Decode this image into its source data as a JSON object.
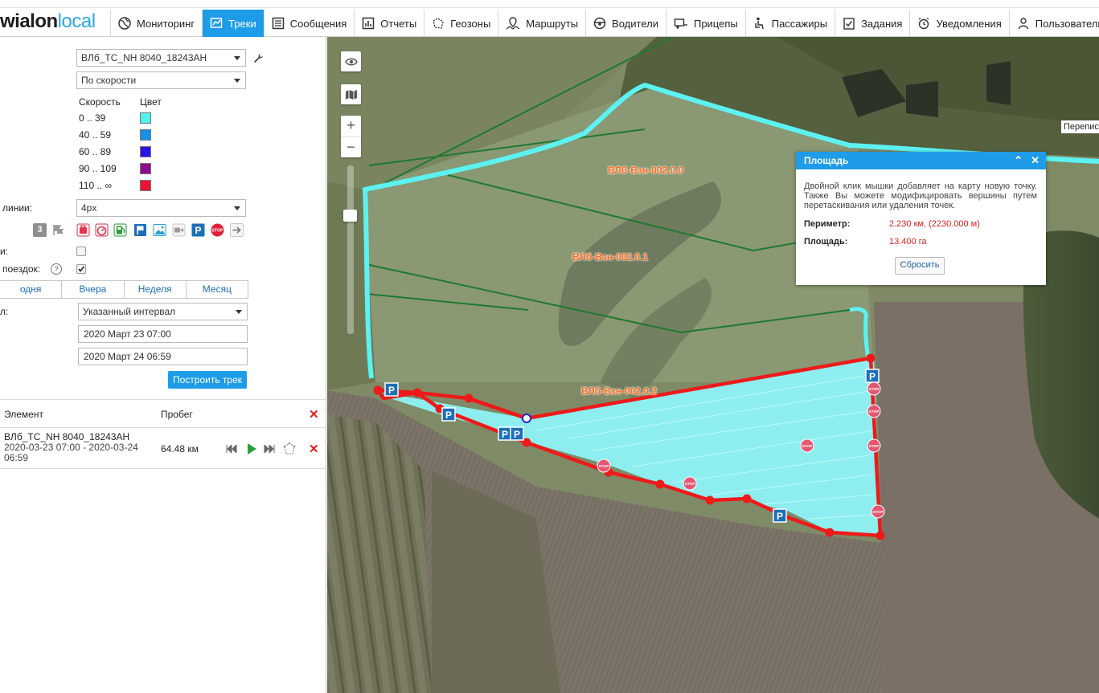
{
  "app": {
    "logo_part1": "wialon",
    "logo_part2": "local",
    "nav": [
      {
        "label": "Мониторинг",
        "icon": "globe-icon"
      },
      {
        "label": "Треки",
        "icon": "track-flag-icon"
      },
      {
        "label": "Сообщения",
        "icon": "messages-icon"
      },
      {
        "label": "Отчеты",
        "icon": "reports-icon"
      },
      {
        "label": "Геозоны",
        "icon": "geofence-icon"
      },
      {
        "label": "Маршруты",
        "icon": "route-icon"
      },
      {
        "label": "Водители",
        "icon": "steering-wheel-icon"
      },
      {
        "label": "Прицепы",
        "icon": "trailer-icon"
      },
      {
        "label": "Пассажиры",
        "icon": "passenger-icon"
      },
      {
        "label": "Задания",
        "icon": "tasks-icon"
      },
      {
        "label": "Уведомления",
        "icon": "alarm-icon"
      },
      {
        "label": "Пользователи",
        "icon": "user-icon"
      },
      {
        "label": "",
        "icon": "bus-icon"
      }
    ],
    "active_nav": "Треки"
  },
  "panel": {
    "unit_select": "ВЛб_ТС_NH 8040_18243AH",
    "color_mode_select": "По скорости",
    "legend_header_speed": "Скорость",
    "legend_header_color": "Цвет",
    "speed_ranges": [
      {
        "range": "0 .. 39",
        "color": "#4ff4ec"
      },
      {
        "range": "40 .. 59",
        "color": "#1690e8"
      },
      {
        "range": "60 .. 89",
        "color": "#2a14e8"
      },
      {
        "range": "90 .. 109",
        "color": "#8c0b8f"
      },
      {
        "range": "110 .. ∞",
        "color": "#ee1233"
      }
    ],
    "line_width_label": "линии:",
    "line_width_value": "4px",
    "tool_badge_number": "3",
    "label_row1": "и:",
    "label_row2": "поездок:",
    "help_symbol": "?",
    "period_tabs": [
      "одня",
      "Вчера",
      "Неделя",
      "Месяц"
    ],
    "interval_label": "л:",
    "interval_select": "Указанный интервал",
    "from_value": "2020 Март 23 07:00",
    "to_value": "2020 Март 24 06:59",
    "build_button": "Построить трек",
    "table_header_element": "Элемент",
    "table_header_mileage": "Пробег",
    "track_name": "ВЛб_ТС_NH 8040_18243AH",
    "track_period": "2020-03-23  07:00 - 2020-03-24  06:59",
    "track_mileage": "64.48 км"
  },
  "map": {
    "field_labels": [
      "ВЛб-Взн-002.0.0",
      "ВЛб-Взн-002.0.1",
      "ВЛб-Взн-002.0.2"
    ],
    "cut_label": "Перепись",
    "area_popup": {
      "title": "Площадь",
      "description": "Двойной клик мышки добавляет на карту новую точку. Также Вы можете модифицировать вершины путем перетаскивания или удаления точек.",
      "perimeter_label": "Периметр:",
      "perimeter_value": "2.230 км, (2230.000 м)",
      "area_label": "Площадь:",
      "area_value": "13.400 га",
      "reset_button": "Сбросить"
    },
    "zoom_in": "+",
    "zoom_out": "−",
    "colors": {
      "track": "#5cf2f2",
      "polygon_fill": "#8ff3f7",
      "polygon_edge": "#ee1a1a",
      "field_line": "#1e7a2e"
    }
  }
}
